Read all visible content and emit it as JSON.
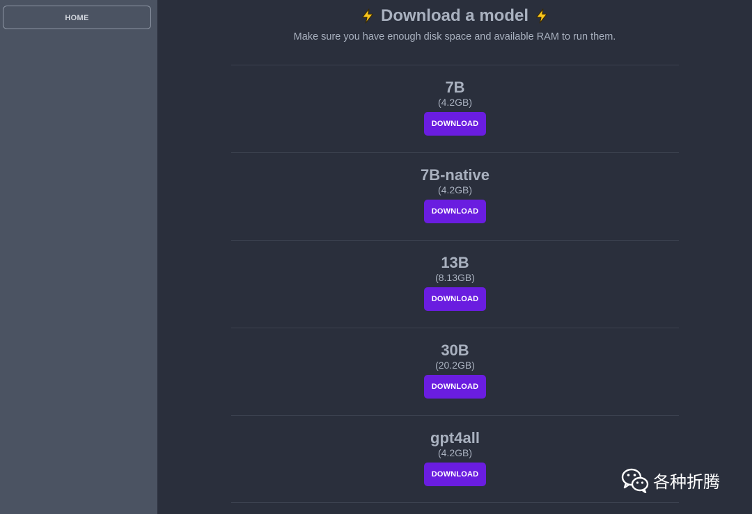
{
  "sidebar": {
    "home_label": "HOME"
  },
  "header": {
    "title": "Download a model",
    "subtitle": "Make sure you have enough disk space and available RAM to run them.",
    "icon": "lightning-bolt-emoji"
  },
  "models": [
    {
      "name": "7B",
      "size": "(4.2GB)",
      "button_label": "DOWNLOAD"
    },
    {
      "name": "7B-native",
      "size": "(4.2GB)",
      "button_label": "DOWNLOAD"
    },
    {
      "name": "13B",
      "size": "(8.13GB)",
      "button_label": "DOWNLOAD"
    },
    {
      "name": "30B",
      "size": "(20.2GB)",
      "button_label": "DOWNLOAD"
    },
    {
      "name": "gpt4all",
      "size": "(4.2GB)",
      "button_label": "DOWNLOAD"
    }
  ],
  "watermark": {
    "text": "各种折腾",
    "icon": "wechat-logo"
  },
  "colors": {
    "sidebar_bg": "#4b5362",
    "main_bg": "#2a2f3c",
    "accent": "#6a1de0",
    "text": "#a9b1bf"
  }
}
